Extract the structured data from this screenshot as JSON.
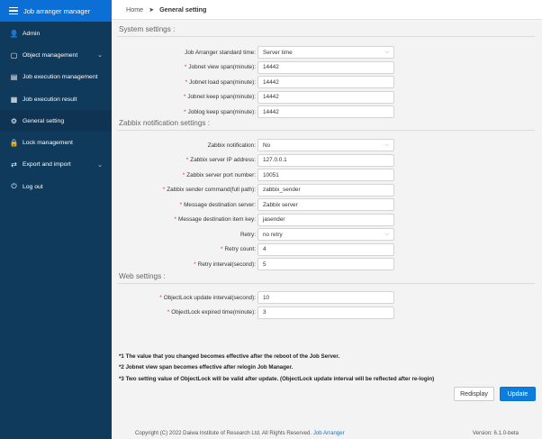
{
  "sidebar": {
    "title": "Job arranger manager",
    "items": [
      {
        "label": "Admin",
        "icon": "user-icon",
        "chevron": false
      },
      {
        "label": "Object management",
        "icon": "folder-icon",
        "chevron": true
      },
      {
        "label": "Job execution management",
        "icon": "list-icon",
        "chevron": false
      },
      {
        "label": "Job execution result",
        "icon": "grid-icon",
        "chevron": false
      },
      {
        "label": "General setting",
        "icon": "gear-icon",
        "chevron": false
      },
      {
        "label": "Lock management",
        "icon": "lock-icon",
        "chevron": false
      },
      {
        "label": "Export and import",
        "icon": "export-icon",
        "chevron": true
      },
      {
        "label": "Log out",
        "icon": "power-icon",
        "chevron": false
      }
    ]
  },
  "breadcrumb": {
    "home": "Home",
    "current": "General setting"
  },
  "system": {
    "title": "System settings :",
    "rows": [
      {
        "label": "Job Arranger standard time",
        "required": false,
        "value": "Server time",
        "dropdown": true
      },
      {
        "label": "Jobnet view span(minute)",
        "required": true,
        "value": "14442",
        "dropdown": false
      },
      {
        "label": "Jobnet load span(minute)",
        "required": true,
        "value": "14442",
        "dropdown": false
      },
      {
        "label": "Jobnet keep span(minute)",
        "required": true,
        "value": "14442",
        "dropdown": false
      },
      {
        "label": "Joblog keep span(minute)",
        "required": true,
        "value": "14442",
        "dropdown": false
      }
    ]
  },
  "zabbix": {
    "title": "Zabbix notification settings :",
    "rows": [
      {
        "label": "Zabbix notification",
        "required": false,
        "value": "No",
        "dropdown": true
      },
      {
        "label": "Zabbix server IP address",
        "required": true,
        "value": "127.0.0.1",
        "dropdown": false
      },
      {
        "label": "Zabbix server port number",
        "required": true,
        "value": "10051",
        "dropdown": false
      },
      {
        "label": "Zabbix sender command(full path)",
        "required": true,
        "value": "zabbix_sender",
        "dropdown": false
      },
      {
        "label": "Message destination server",
        "required": true,
        "value": "Zabbix server",
        "dropdown": false
      },
      {
        "label": "Message destination item key",
        "required": true,
        "value": "jasender",
        "dropdown": false
      },
      {
        "label": "Retry",
        "required": false,
        "value": "no retry",
        "dropdown": true
      },
      {
        "label": "Retry count",
        "required": true,
        "value": "4",
        "dropdown": false
      },
      {
        "label": "Retry interval(second)",
        "required": true,
        "value": "5",
        "dropdown": false
      }
    ]
  },
  "web": {
    "title": "Web settings :",
    "rows": [
      {
        "label": "ObjectLock update interval(second)",
        "required": true,
        "value": "10",
        "dropdown": false
      },
      {
        "label": "ObjectLock expired time(minute)",
        "required": true,
        "value": "3",
        "dropdown": false
      }
    ]
  },
  "notes": [
    "*1 The value that you changed becomes effective after the reboot of the Job Server.",
    "*2 Jobnet view span becomes effective after relogin Job Manager.",
    "*3 Two setting value of ObjectLock will be valid after update. (ObjectLock update interval will be reflected after re-login)"
  ],
  "buttons": {
    "redisplay": "Redisplay",
    "update": "Update"
  },
  "footer": {
    "copyright": "Copyright (C) 2022 Daiwa Institute of Research Ltd. All Rights Reserved.",
    "link": "Job Arranger",
    "version": "Version: 6.1.0-beta"
  }
}
